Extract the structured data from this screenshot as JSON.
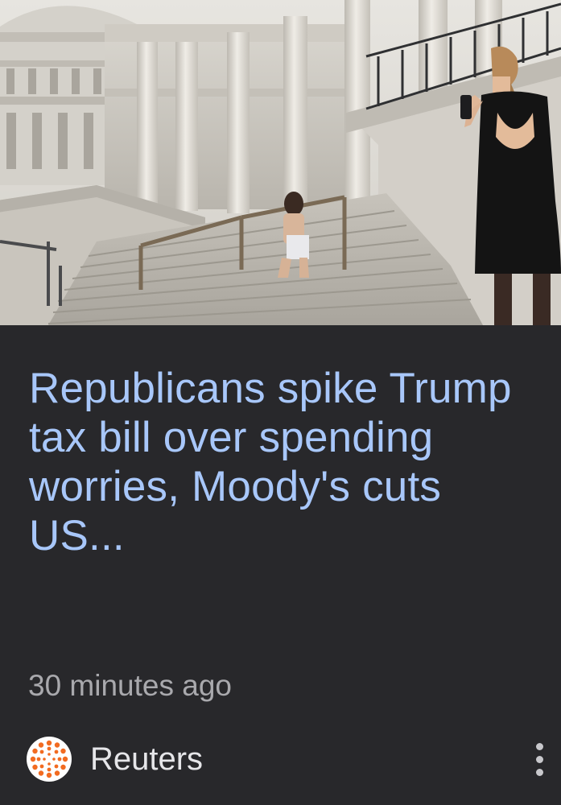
{
  "article": {
    "image_subject": "woman photographing person on Capitol steps",
    "headline": "Republicans spike Trump tax bill over spending worries, Moody's cuts US...",
    "timestamp": "30 minutes ago",
    "source": {
      "name": "Reuters",
      "logo_icon": "reuters-logo-icon"
    },
    "menu_icon": "more-vert-icon"
  },
  "colors": {
    "card_background": "#28282b",
    "headline": "#a8c7fa",
    "timestamp": "#a9a9ad",
    "source_name": "#e6e6e9",
    "reuters_orange": "#f26b21"
  }
}
